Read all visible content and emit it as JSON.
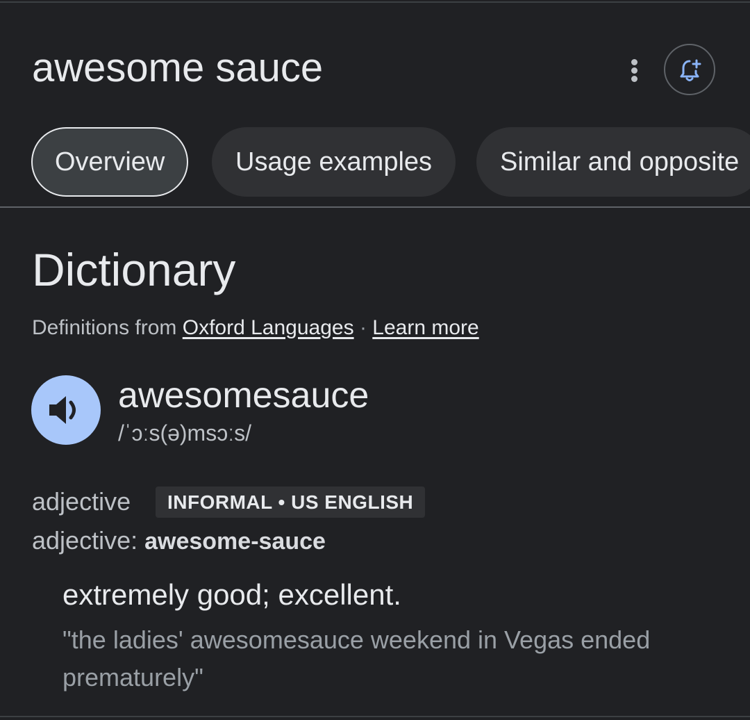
{
  "header": {
    "query": "awesome sauce",
    "more_icon": "more-vert-icon",
    "alert_icon": "bell-plus-icon"
  },
  "tabs": [
    {
      "label": "Overview",
      "active": true
    },
    {
      "label": "Usage examples",
      "active": false
    },
    {
      "label": "Similar and opposite",
      "active": false
    }
  ],
  "dictionary": {
    "heading": "Dictionary",
    "source_prefix": "Definitions from",
    "source_link": "Oxford Languages",
    "separator": "·",
    "learn_more": "Learn more",
    "speaker_icon": "volume-up-icon",
    "headword": "awesomesauce",
    "phonetic": "/ˈɔːs(ə)msɔːs/",
    "part_of_speech": "adjective",
    "register": "INFORMAL • US ENGLISH",
    "variant_prefix": "adjective:",
    "variant": "awesome-sauce",
    "definition": "extremely good; excellent.",
    "example": "\"the ladies' awesomesauce weekend in Vegas ended prematurely\""
  },
  "colors": {
    "background": "#202124",
    "chip": "#303134",
    "speaker_fill": "#a8c7fa",
    "accent_icon": "#8ab4f8"
  }
}
